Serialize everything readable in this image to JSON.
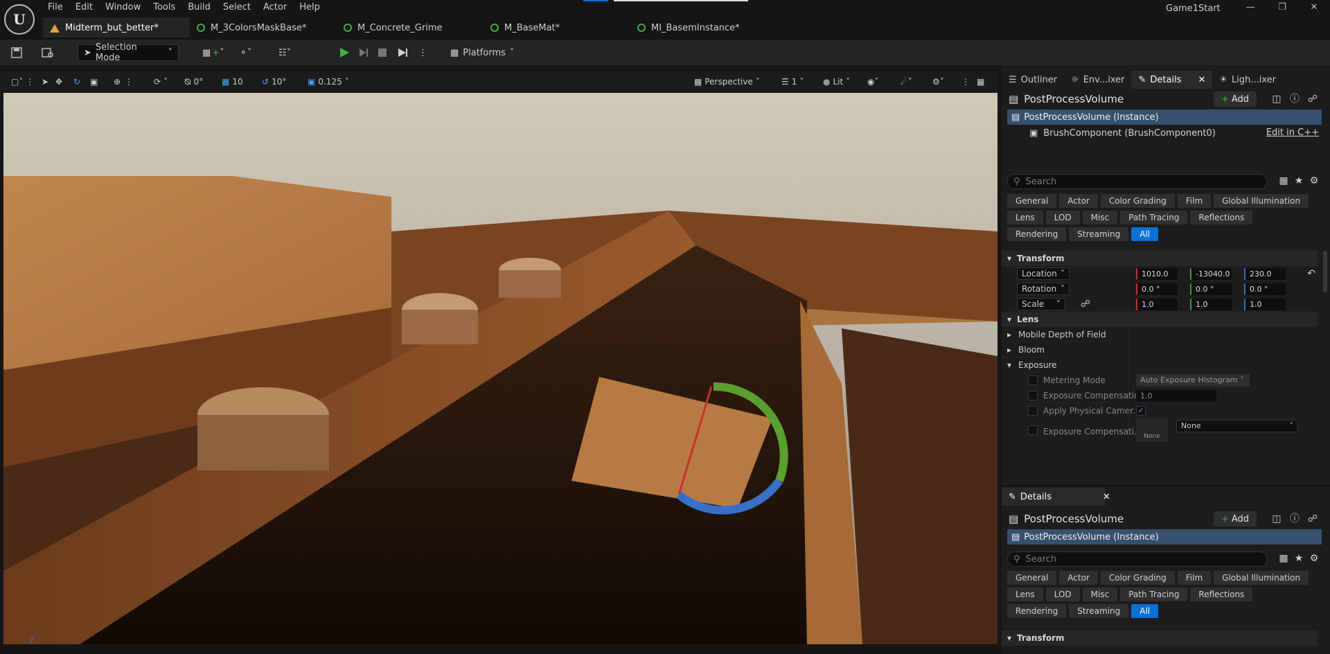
{
  "menu": [
    "File",
    "Edit",
    "Window",
    "Tools",
    "Build",
    "Select",
    "Actor",
    "Help"
  ],
  "project_name": "Game1Start",
  "doc_tabs": [
    {
      "label": "Midterm_but_better*",
      "active": true
    },
    {
      "label": "M_3ColorsMaskBase*",
      "active": false
    },
    {
      "label": "M_Concrete_Grime",
      "active": false
    },
    {
      "label": "M_BaseMat*",
      "active": false
    },
    {
      "label": "MI_BasemInstance*",
      "active": false
    }
  ],
  "toolbar": {
    "selection_mode": "Selection Mode",
    "platforms": "Platforms"
  },
  "viewport_bar": {
    "rotate_snap": "0°",
    "grid_snap": "10",
    "angle_snap": "10°",
    "scale_snap": "0.125",
    "perspective": "Perspective",
    "screen_count": "1",
    "lit": "Lit"
  },
  "right_tabs": [
    {
      "label": "Outliner",
      "active": false
    },
    {
      "label": "Env...ixer",
      "active": false
    },
    {
      "label": "Details",
      "active": true
    },
    {
      "label": "Ligh...ixer",
      "active": false
    }
  ],
  "details": {
    "actor_name": "PostProcessVolume",
    "add_label": "Add",
    "instance_row": "PostProcessVolume (Instance)",
    "component_row": "BrushComponent (BrushComponent0)",
    "edit_cpp": "Edit in C++",
    "search_placeholder": "Search",
    "filters_row1": [
      "General",
      "Actor",
      "Color Grading",
      "Film",
      "Global Illumination"
    ],
    "filters_row2": [
      "Lens",
      "LOD",
      "Misc",
      "Path Tracing",
      "Reflections"
    ],
    "filters_row3": [
      "Rendering",
      "Streaming",
      "All"
    ],
    "transform_label": "Transform",
    "location_label": "Location",
    "rotation_label": "Rotation",
    "scale_label": "Scale",
    "location": [
      "1010.0",
      "-13040.0",
      "230.0"
    ],
    "rotation": [
      "0.0 °",
      "0.0 °",
      "0.0 °"
    ],
    "scale": [
      "1.0",
      "1.0",
      "1.0"
    ],
    "lens_label": "Lens",
    "mobile_dof": "Mobile Depth of Field",
    "bloom": "Bloom",
    "exposure": "Exposure",
    "metering_mode": "Metering Mode",
    "metering_value": "Auto Exposure Histogram",
    "exposure_comp": "Exposure Compensation",
    "exposure_comp_value": "1.0",
    "apply_physical": "Apply Physical Camer...",
    "exposure_comp_curve": "Exposure Compensati...",
    "none_thumb": "None",
    "none_value": "None"
  },
  "details2": {
    "tab_label": "Details",
    "actor_name": "PostProcessVolume",
    "add_label": "Add",
    "instance_row": "PostProcessVolume (Instance)",
    "search_placeholder": "Search",
    "transform_label": "Transform"
  },
  "axis_label": "Z"
}
